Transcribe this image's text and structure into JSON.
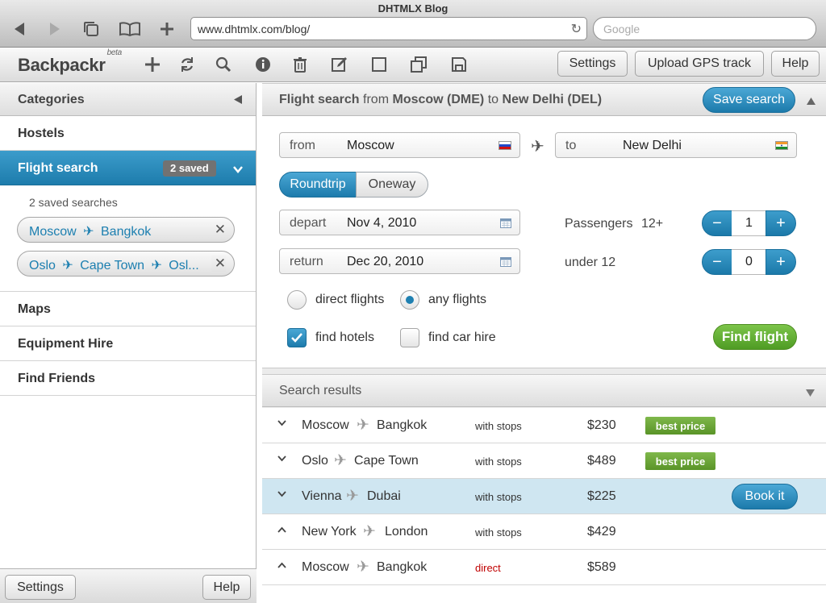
{
  "browser": {
    "window_title": "DHTMLX Blog",
    "url": "www.dhtmlx.com/blog/",
    "search_placeholder": "Google"
  },
  "app": {
    "name": "Backpackr",
    "name_tag": "beta",
    "toolbar_buttons": {
      "settings": "Settings",
      "upload": "Upload GPS track",
      "help": "Help"
    }
  },
  "sidebar": {
    "header": "Categories",
    "items": [
      {
        "label": "Hostels"
      },
      {
        "label": "Flight search",
        "badge": "2 saved"
      },
      {
        "label": "Maps"
      },
      {
        "label": "Equipment Hire"
      },
      {
        "label": "Find Friends"
      }
    ],
    "saved_caption": "2 saved searches",
    "saved_searches": [
      {
        "from": "Moscow",
        "to": "Bangkok"
      },
      {
        "from": "Oslo",
        "to": "Cape Town",
        "more": "Osl..."
      }
    ],
    "footer": {
      "settings": "Settings",
      "help": "Help"
    }
  },
  "flight_search": {
    "title": "Flight search",
    "from_word": "from",
    "origin": "Moscow (DME)",
    "to_word": "to",
    "destination": "New Delhi (DEL)",
    "save_button": "Save search",
    "from_label": "from",
    "from_value": "Moscow",
    "to_label": "to",
    "to_value": "New Delhi",
    "trip_types": [
      "Roundtrip",
      "Oneway"
    ],
    "depart_label": "depart",
    "depart_value": "Nov 4, 2010",
    "return_label": "return",
    "return_value": "Dec 20, 2010",
    "passengers_label": "Passengers",
    "adults_label": "12+",
    "adults_count": "1",
    "children_label": "under 12",
    "children_count": "0",
    "stepper_minus": "−",
    "stepper_plus": "+",
    "direct_label": "direct flights",
    "any_label": "any flights",
    "hotels_label": "find hotels",
    "car_label": "find car hire",
    "find_button": "Find flight"
  },
  "results": {
    "title": "Search results",
    "book_button": "Book it",
    "rows": [
      {
        "from": "Moscow",
        "to": "Bangkok",
        "stops": "with stops",
        "price": "$230",
        "badge": "best price"
      },
      {
        "from": "Oslo",
        "to": "Cape Town",
        "stops": "with stops",
        "price": "$489",
        "badge": "best price"
      },
      {
        "from": "Vienna",
        "to": "Dubai",
        "stops": "with stops",
        "price": "$225",
        "badge": ""
      },
      {
        "from": "New York",
        "to": "London",
        "stops": "with stops",
        "price": "$429",
        "badge": ""
      },
      {
        "from": "Moscow",
        "to": "Bangkok",
        "stops": "direct",
        "price": "$589",
        "badge": ""
      }
    ]
  },
  "colors": {
    "accent_blue": "#1d7cac",
    "green": "#5a9428",
    "direct_red": "#c00000"
  }
}
